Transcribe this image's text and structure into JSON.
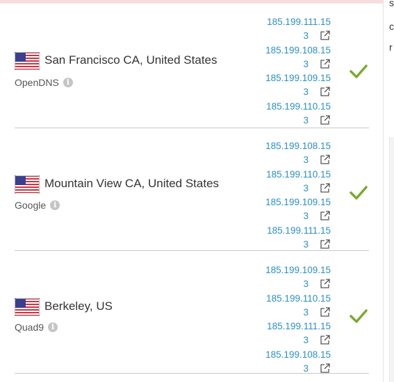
{
  "icons": {
    "flag": "us-flag-icon",
    "info": "info-icon",
    "external": "external-link-icon",
    "status": "check-icon"
  },
  "colors": {
    "link": "#2a8fc7",
    "check": "#7aaa2e",
    "divider": "#c9c9c9"
  },
  "edge_text": [
    "s",
    "c",
    "r"
  ],
  "results": [
    {
      "location": "San Francisco CA, United States",
      "provider": "OpenDNS",
      "ips": [
        {
          "line1": "185.199.111.15",
          "line2": "3"
        },
        {
          "line1": "185.199.108.15",
          "line2": "3"
        },
        {
          "line1": "185.199.109.15",
          "line2": "3"
        },
        {
          "line1": "185.199.110.15",
          "line2": "3"
        }
      ]
    },
    {
      "location": "Mountain View CA, United States",
      "provider": "Google",
      "ips": [
        {
          "line1": "185.199.108.15",
          "line2": "3"
        },
        {
          "line1": "185.199.110.15",
          "line2": "3"
        },
        {
          "line1": "185.199.109.15",
          "line2": "3"
        },
        {
          "line1": "185.199.111.15",
          "line2": "3"
        }
      ]
    },
    {
      "location": "Berkeley, US",
      "provider": "Quad9",
      "ips": [
        {
          "line1": "185.199.109.15",
          "line2": "3"
        },
        {
          "line1": "185.199.110.15",
          "line2": "3"
        },
        {
          "line1": "185.199.111.15",
          "line2": "3"
        },
        {
          "line1": "185.199.108.15",
          "line2": "3"
        }
      ]
    }
  ]
}
